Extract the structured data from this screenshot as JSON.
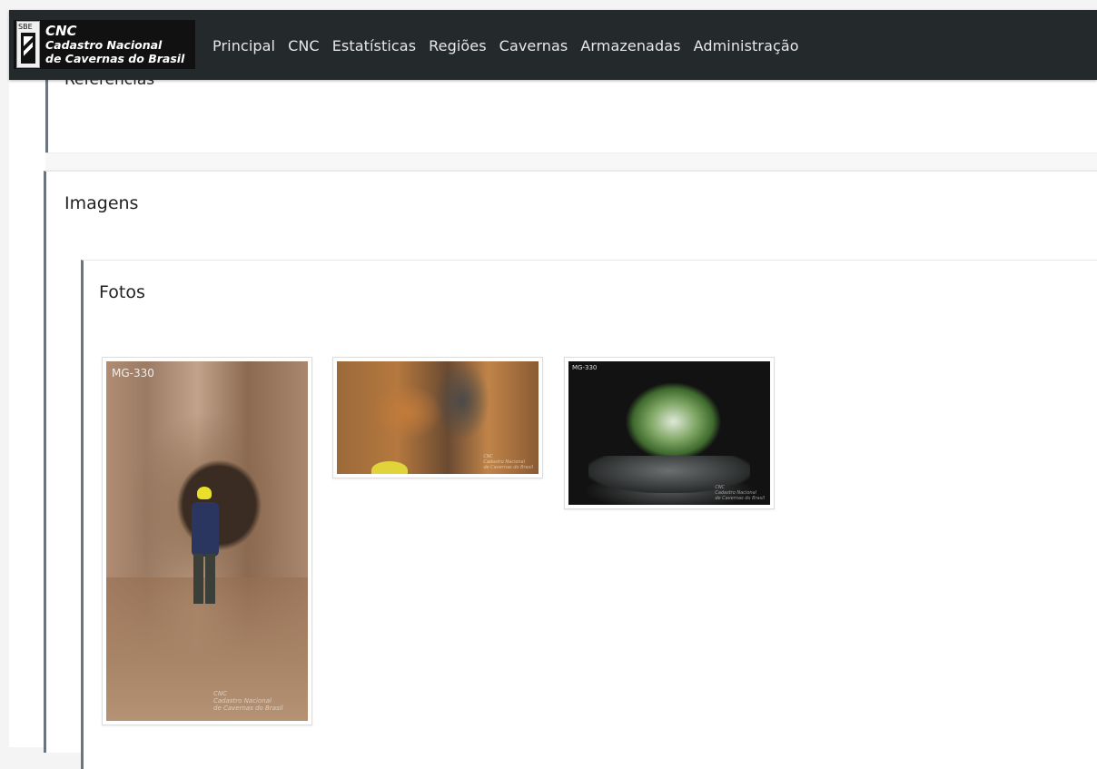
{
  "navbar": {
    "brand": {
      "logo_text": "SBE",
      "title": "CNC",
      "subtitle_line1": "Cadastro Nacional",
      "subtitle_line2": "de Cavernas do Brasil"
    },
    "menu": [
      {
        "label": "Principal"
      },
      {
        "label": "CNC"
      },
      {
        "label": "Estatísticas"
      },
      {
        "label": "Regiões"
      },
      {
        "label": "Cavernas"
      },
      {
        "label": "Armazenadas"
      },
      {
        "label": "Administração"
      }
    ]
  },
  "sections": {
    "previous_title": "Referências",
    "imagens_title": "Imagens",
    "fotos_title": "Fotos"
  },
  "photos": [
    {
      "label": "MG-330",
      "watermark": [
        "CNC",
        "Cadastro Nacional",
        "de Cavernas do Brasil"
      ]
    },
    {
      "label": "",
      "watermark": [
        "CNC",
        "Cadastro Nacional",
        "de Cavernas do Brasil"
      ]
    },
    {
      "label": "MG-330",
      "watermark": [
        "CNC",
        "Cadastro Nacional",
        "de Cavernas do Brasil"
      ]
    }
  ]
}
